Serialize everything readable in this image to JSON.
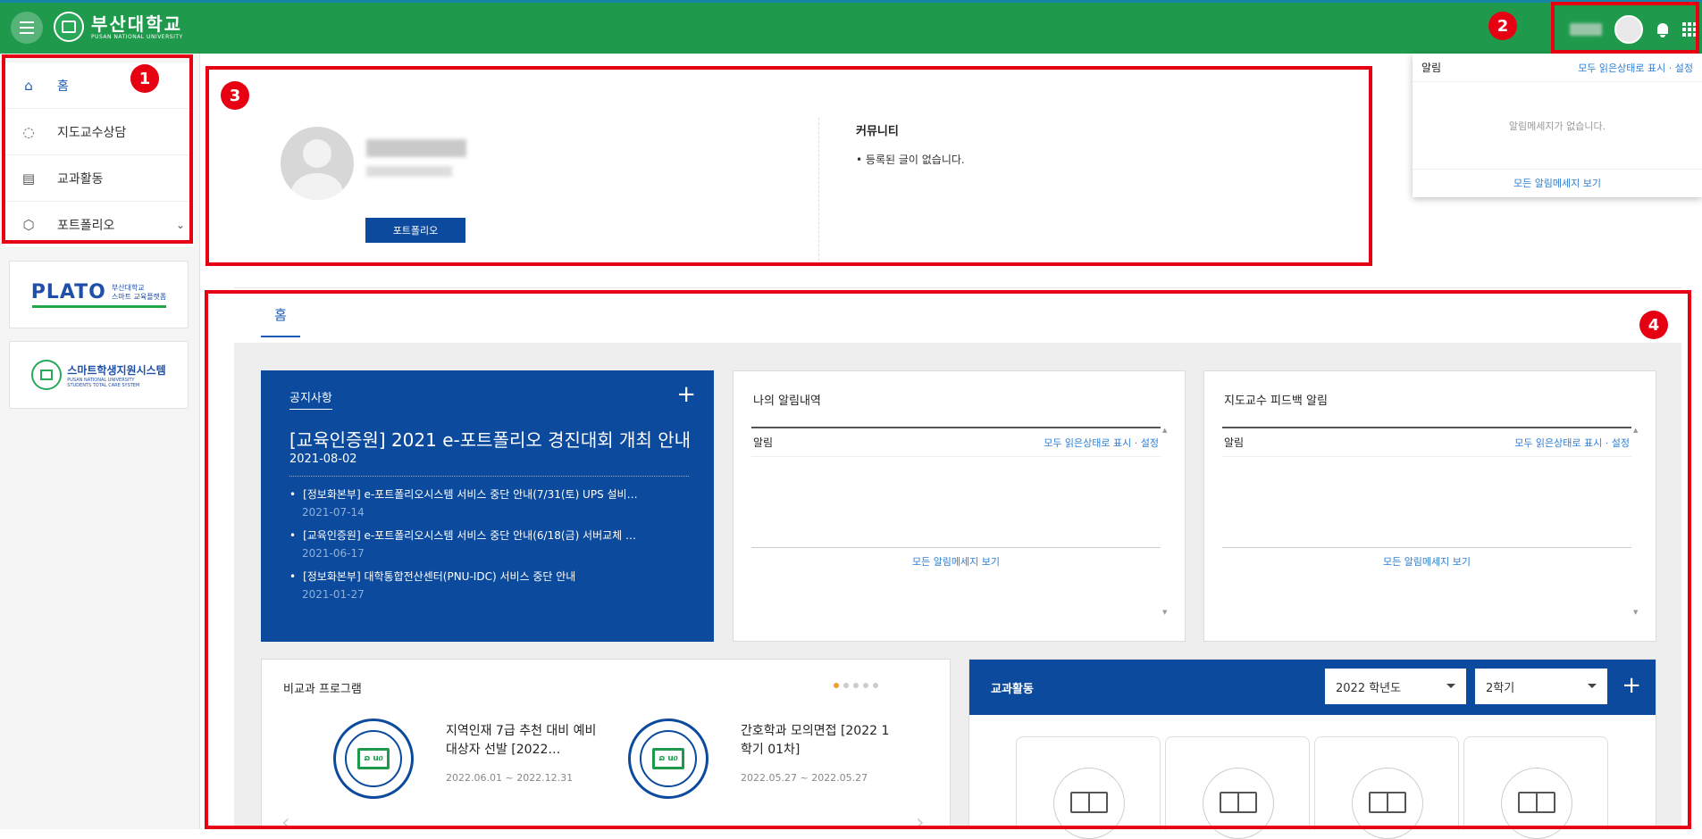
{
  "header": {
    "logo_title": "부산대학교",
    "logo_subtitle": "PUSAN NATIONAL UNIVERSITY",
    "brand_color": "#1f9a4c"
  },
  "annotations": {
    "b1": "1",
    "b2": "2",
    "b3": "3",
    "b4": "4"
  },
  "sidebar": {
    "items": [
      {
        "label": "홈",
        "icon": "home-icon"
      },
      {
        "label": "지도교수상담",
        "icon": "chat-icon"
      },
      {
        "label": "교과활동",
        "icon": "document-icon"
      },
      {
        "label": "포트폴리오",
        "icon": "cube-icon"
      }
    ],
    "plato_logo": "PLATO",
    "plato_sub1": "부산대학교",
    "plato_sub2": "스마트 교육플랫폼",
    "smart_title": "스마트학생지원시스템",
    "smart_sub1": "PUSAN NATIONAL UNIVERSITY",
    "smart_sub2": "STUDENTS TOTAL CARE SYSTEM"
  },
  "notification_popup": {
    "title": "알림",
    "action": "모두 읽은상태로 표시 · 설정",
    "empty": "알림메세지가 없습니다.",
    "view_all": "모든 알림메세지 보기"
  },
  "profile": {
    "portfolio_button": "포트폴리오",
    "community_title": "커뮤니티",
    "community_item": "등록된 글이 없습니다."
  },
  "tabs": {
    "home": "홈"
  },
  "notice": {
    "label": "공지사항",
    "headline": "[교육인증원] 2021 e-포트폴리오 경진대회 개최 안내",
    "headline_date": "2021-08-02",
    "items": [
      {
        "title": "[정보화본부] e-포트폴리오시스템 서비스 중단 안내(7/31(토) UPS 설비…",
        "date": "2021-07-14"
      },
      {
        "title": "[교육인증원] e-포트폴리오시스템 서비스 중단 안내(6/18(금) 서버교체 …",
        "date": "2021-06-17"
      },
      {
        "title": "[정보화본부] 대학통합전산센터(PNU-IDC) 서비스 중단 안내",
        "date": "2021-01-27"
      }
    ]
  },
  "my_alerts": {
    "title": "나의 알림내역",
    "col": "알림",
    "action": "모두 읽은상태로 표시 · 설정",
    "view_all": "모든 알림메세지 보기"
  },
  "advisor_alerts": {
    "title": "지도교수 피드백 알림",
    "col": "알림",
    "action": "모두 읽은상태로 표시 · 설정",
    "view_all": "모든 알림메세지 보기"
  },
  "programs": {
    "title": "비교과 프로그램",
    "items": [
      {
        "name": "지역인재 7급 추천 대비 예비대상자 선발 [2022…",
        "date": "2022.06.01 ~ 2022.12.31"
      },
      {
        "name": "간호학과 모의면접 [2022 1학기 01차]",
        "date": "2022.05.27 ~ 2022.05.27"
      }
    ],
    "seal_text": "ລ uዐ"
  },
  "course": {
    "title": "교과활동",
    "year": "2022 학년도",
    "semester": "2학기"
  }
}
